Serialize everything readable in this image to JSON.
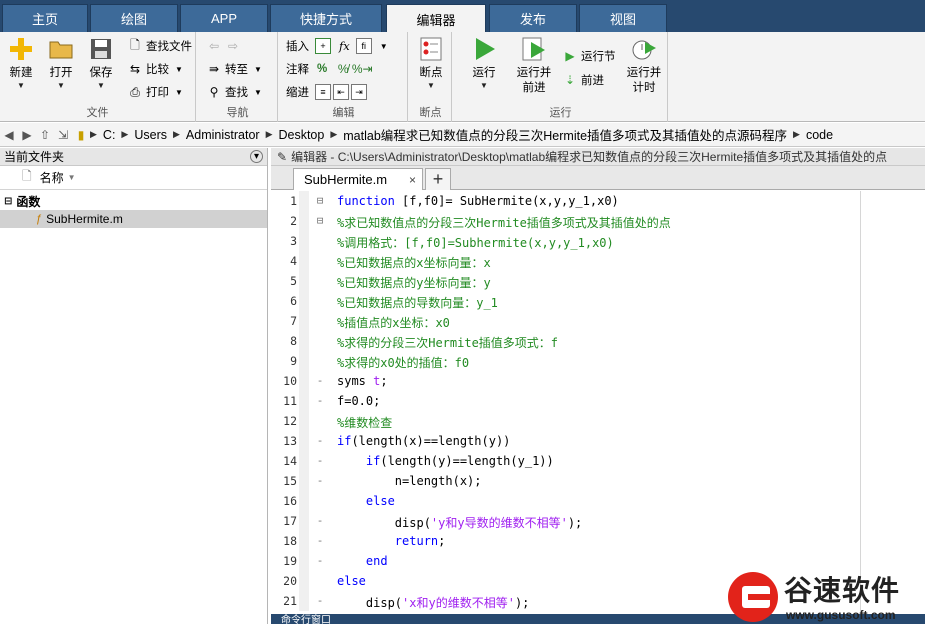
{
  "tabs": [
    {
      "label": "主页"
    },
    {
      "label": "绘图"
    },
    {
      "label": "APP"
    },
    {
      "label": "快捷方式"
    },
    {
      "label": "编辑器",
      "active": true
    },
    {
      "label": "发布"
    },
    {
      "label": "视图"
    }
  ],
  "ribbon": {
    "file": {
      "new": "新建",
      "open": "打开",
      "save": "保存",
      "find_files": "查找文件",
      "compare": "比较",
      "print": "打印",
      "label": "文件"
    },
    "navigate": {
      "goto": "转至",
      "find": "查找",
      "label": "导航"
    },
    "edit": {
      "insert": "插入",
      "fx": "fx",
      "comment": "注释",
      "comment_sym": "%",
      "indent": "缩进",
      "label": "编辑"
    },
    "breakpoints": {
      "breakpoints": "断点",
      "label": "断点"
    },
    "run": {
      "run": "运行",
      "run_advance_l1": "运行并",
      "run_advance_l2": "前进",
      "run_section": "运行节",
      "advance": "前进",
      "run_time_l1": "运行并",
      "run_time_l2": "计时",
      "label": "运行"
    }
  },
  "address": [
    "C:",
    "Users",
    "Administrator",
    "Desktop",
    "matlab编程求已知数值点的分段三次Hermite插值多项式及其插值处的点源码程序",
    "code"
  ],
  "left_panel": {
    "title": "当前文件夹",
    "col_name": "名称",
    "group": "函数",
    "file": "SubHermite.m"
  },
  "editor": {
    "title": "编辑器 - C:\\Users\\Administrator\\Desktop\\matlab编程求已知数值点的分段三次Hermite插值多项式及其插值处的点",
    "tab": "SubHermite.m",
    "tab_close": "×",
    "add_tab": "+",
    "lines": [
      {
        "n": "1",
        "mark": "⊟",
        "html": [
          [
            "kw",
            "function "
          ],
          [
            "",
            "[f,f0]= SubHermite(x,y,y_1,x0)"
          ]
        ]
      },
      {
        "n": "2",
        "mark": "⊟",
        "html": [
          [
            "cm",
            "%求已知数值点的分段三次Hermite插值多项式及其插值处的点"
          ]
        ]
      },
      {
        "n": "3",
        "mark": "",
        "html": [
          [
            "cm",
            "%调用格式：[f,f0]=Subhermite(x,y,y_1,x0)"
          ]
        ]
      },
      {
        "n": "4",
        "mark": "",
        "html": [
          [
            "cm",
            "%已知数据点的x坐标向量：x"
          ]
        ]
      },
      {
        "n": "5",
        "mark": "",
        "html": [
          [
            "cm",
            "%已知数据点的y坐标向量：y"
          ]
        ]
      },
      {
        "n": "6",
        "mark": "",
        "html": [
          [
            "cm",
            "%已知数据点的导数向量：y_1"
          ]
        ]
      },
      {
        "n": "7",
        "mark": "",
        "html": [
          [
            "cm",
            "%插值点的x坐标：x0"
          ]
        ]
      },
      {
        "n": "8",
        "mark": "",
        "html": [
          [
            "cm",
            "%求得的分段三次Hermite插值多项式：f"
          ]
        ]
      },
      {
        "n": "9",
        "mark": "",
        "html": [
          [
            "cm",
            "%求得的x0处的插值：f0"
          ]
        ]
      },
      {
        "n": "10",
        "mark": "-",
        "html": [
          [
            "",
            "syms "
          ],
          [
            "st",
            "t"
          ],
          [
            "",
            ";"
          ]
        ]
      },
      {
        "n": "11",
        "mark": "-",
        "html": [
          [
            "",
            "f=0.0;"
          ]
        ]
      },
      {
        "n": "12",
        "mark": "",
        "html": [
          [
            "cm",
            "%维数检查"
          ]
        ]
      },
      {
        "n": "13",
        "mark": "-",
        "html": [
          [
            "kw",
            "if"
          ],
          [
            "",
            "(length(x)==length(y))"
          ]
        ]
      },
      {
        "n": "14",
        "mark": "-",
        "html": [
          [
            "",
            "    "
          ],
          [
            "kw",
            "if"
          ],
          [
            "",
            "(length(y)==length(y_1))"
          ]
        ]
      },
      {
        "n": "15",
        "mark": "-",
        "html": [
          [
            "",
            "        n=length(x);"
          ]
        ]
      },
      {
        "n": "16",
        "mark": "",
        "html": [
          [
            "",
            "    "
          ],
          [
            "kw",
            "else"
          ]
        ]
      },
      {
        "n": "17",
        "mark": "-",
        "html": [
          [
            "",
            "        disp("
          ],
          [
            "st",
            "'y和y导数的维数不相等'"
          ],
          [
            "",
            ");"
          ]
        ]
      },
      {
        "n": "18",
        "mark": "-",
        "html": [
          [
            "",
            "        "
          ],
          [
            "kw",
            "return"
          ],
          [
            "",
            ";"
          ]
        ]
      },
      {
        "n": "19",
        "mark": "-",
        "html": [
          [
            "",
            "    "
          ],
          [
            "kw",
            "end"
          ]
        ]
      },
      {
        "n": "20",
        "mark": "",
        "html": [
          [
            "kw",
            "else"
          ]
        ]
      },
      {
        "n": "21",
        "mark": "-",
        "html": [
          [
            "",
            "    disp("
          ],
          [
            "st",
            "'x和y的维数不相等'"
          ],
          [
            "",
            ");"
          ]
        ]
      }
    ]
  },
  "command_window": "命令行窗口",
  "watermark": {
    "name": "谷速软件",
    "url": "www.gususoft.com"
  }
}
